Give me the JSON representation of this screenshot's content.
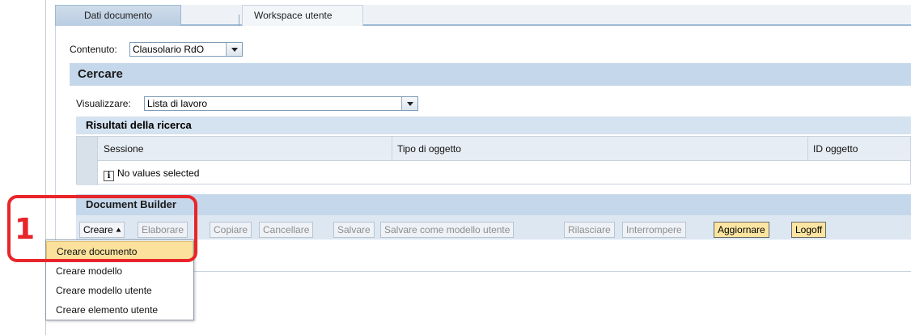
{
  "tabs": {
    "active": "Dati documento",
    "inactive": "Workspace utente"
  },
  "content": {
    "label": "Contenuto:",
    "value": "Clausolario RdO"
  },
  "search": {
    "title": "Cercare",
    "view_label": "Visualizzare:",
    "view_value": "Lista di lavoro"
  },
  "results": {
    "title": "Risultati della ricerca",
    "columns": [
      "Sessione",
      "Tipo di oggetto",
      "ID oggetto"
    ],
    "empty_text": "No values selected"
  },
  "document_builder": {
    "title": "Document Builder",
    "buttons": [
      {
        "label": "Creare",
        "enabled": true
      },
      {
        "label": "Elaborare",
        "enabled": false
      },
      {
        "label": "Copiare",
        "enabled": false
      },
      {
        "label": "Cancellare",
        "enabled": false
      },
      {
        "label": "Salvare",
        "enabled": false
      },
      {
        "label": "Salvare come modello utente",
        "enabled": false
      },
      {
        "label": "Rilasciare",
        "enabled": false
      },
      {
        "label": "Interrompere",
        "enabled": false
      },
      {
        "label": "Aggiornare",
        "enabled": true
      },
      {
        "label": "Logoff",
        "enabled": true
      }
    ]
  },
  "create_menu": {
    "items": [
      "Creare documento",
      "Creare modello",
      "Creare modello utente",
      "Creare elemento utente"
    ],
    "highlighted": "Creare documento"
  },
  "callout": {
    "number": "1",
    "color": "#e8252a"
  },
  "colors": {
    "section_bg": "#c5d7ea",
    "highlight": "#fbe19b"
  }
}
